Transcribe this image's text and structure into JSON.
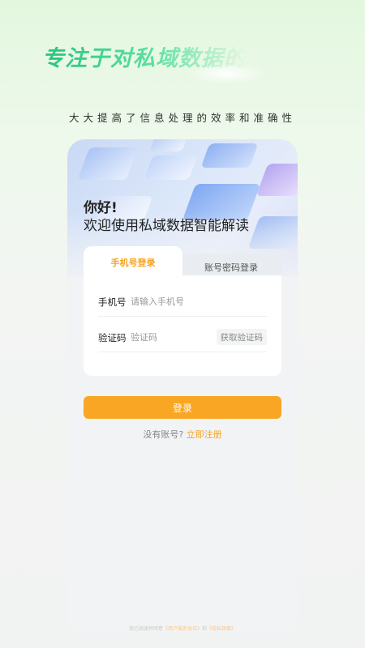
{
  "hero": {
    "slogan": "专注于对私域数据的",
    "subtitle": "大大提高了信息处理的效率和准确性"
  },
  "card": {
    "greeting_title": "你好!",
    "greeting_subtitle": "欢迎使用私域数据智能解读"
  },
  "tabs": {
    "phone_login": "手机号登录",
    "password_login": "账号密码登录",
    "active": "phone_login"
  },
  "form": {
    "phone_label": "手机号",
    "phone_placeholder": "请输入手机号",
    "code_label": "验证码",
    "code_placeholder": "验证码",
    "get_code_button": "获取验证码"
  },
  "actions": {
    "login_button": "登录",
    "no_account": "没有账号?",
    "register_link": "立即注册"
  },
  "footer": {
    "text": "我已阅读并同意",
    "link1": "《用户服务协议》",
    "and": "和",
    "link2": "《隐私政策》"
  },
  "colors": {
    "accent": "#f8a623",
    "slogan_green": "#3fcf8e",
    "background_top": "#e3f7de",
    "card_bg": "#f2f3f4"
  }
}
